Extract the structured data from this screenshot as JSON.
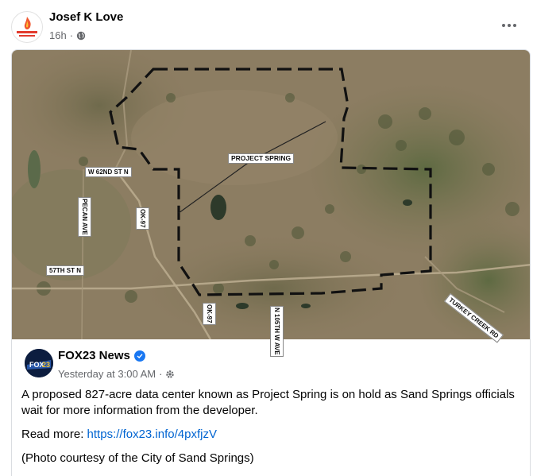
{
  "post": {
    "author": "Josef K Love",
    "time": "16h",
    "separator": "·",
    "privacy_icon": "globe-icon",
    "more_icon": "more-options-icon"
  },
  "shared": {
    "page_name": "FOX23 News",
    "verified_icon": "verified-badge-icon",
    "time": "Yesterday at 3:00 AM",
    "separator": "·",
    "privacy_icon": "settings-icon",
    "text": "A proposed 827-acre data center known as Project Spring is on hold as Sand Springs officials wait for more information from the developer.",
    "read_more_label": "Read more:",
    "read_more_link": "https://fox23.info/4pxfjzV",
    "photo_credit": "(Photo courtesy of the City of Sand Springs)"
  },
  "map": {
    "labels": {
      "project": "PROJECT SPRING",
      "w62": "W 62ND ST N",
      "pecan": "PECAN AVE",
      "st57": "57TH ST N",
      "ok97_a": "OK-97",
      "ok97_b": "OK-97",
      "n105": "N 105TH W AVE",
      "turkey": "TURKEY CREEK RD"
    }
  },
  "colors": {
    "text_primary": "#050505",
    "text_secondary": "#65676b",
    "link": "#0064d1",
    "verified": "#1877f2"
  }
}
